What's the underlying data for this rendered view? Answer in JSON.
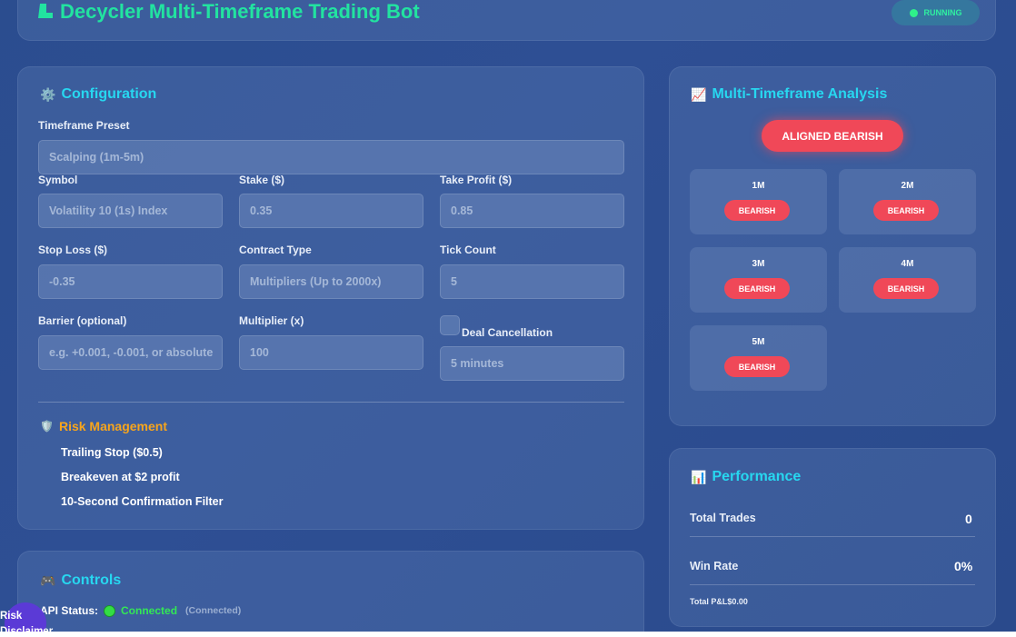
{
  "header": {
    "title": "Decycler Multi-Timeframe Trading Bot",
    "title_icon": "bot-icon",
    "status": "RUNNING"
  },
  "config": {
    "title": "Configuration",
    "title_icon": "gear-icon",
    "timeframe_preset": {
      "label": "Timeframe Preset",
      "value": "Scalping (1m-5m)"
    },
    "symbol": {
      "label": "Symbol",
      "value": "Volatility 10 (1s) Index"
    },
    "stake": {
      "label": "Stake ($)",
      "value": "0.35"
    },
    "take_profit": {
      "label": "Take Profit ($)",
      "value": "0.85"
    },
    "stop_loss": {
      "label": "Stop Loss ($)",
      "value": "-0.35"
    },
    "contract_type": {
      "label": "Contract Type",
      "value": "Multipliers (Up to 2000x)"
    },
    "tick_count": {
      "label": "Tick Count",
      "value": "5"
    },
    "barrier": {
      "label": "Barrier (optional)",
      "placeholder": "e.g. +0.001, -0.001, or absolute"
    },
    "multiplier": {
      "label": "Multiplier (x)",
      "value": "100"
    },
    "deal_cancellation": {
      "label": "Deal Cancellation",
      "checked": false,
      "value": "5 minutes"
    },
    "risk": {
      "title": "Risk Management",
      "icon": "shield-icon",
      "items": [
        "Trailing Stop ($0.5)",
        "Breakeven at $2 profit",
        "10-Second Confirmation Filter"
      ]
    }
  },
  "controls": {
    "title": "Controls",
    "icon": "gamepad-icon",
    "api_label": "API Status:",
    "api_status": "Connected",
    "api_status_detail": "(Connected)",
    "status_color": "#33dd44"
  },
  "analysis": {
    "title": "Multi-Timeframe Analysis",
    "icon": "chart-increasing-icon",
    "aligned": "ALIGNED BEARISH",
    "timeframes": [
      {
        "name": "1M",
        "signal": "BEARISH"
      },
      {
        "name": "2M",
        "signal": "BEARISH"
      },
      {
        "name": "3M",
        "signal": "BEARISH"
      },
      {
        "name": "4M",
        "signal": "BEARISH"
      },
      {
        "name": "5M",
        "signal": "BEARISH"
      }
    ],
    "bearish_color": "#f04858"
  },
  "performance": {
    "title": "Performance",
    "icon": "bar-chart-icon",
    "total_trades_label": "Total Trades",
    "total_trades": "0",
    "win_rate_label": "Win Rate",
    "win_rate": "0%",
    "total_pnl_label": "Total P&L",
    "total_pnl": "$0.00"
  },
  "risk_disclaimer": {
    "line1": "Risk",
    "line2": "Disclaimer"
  }
}
